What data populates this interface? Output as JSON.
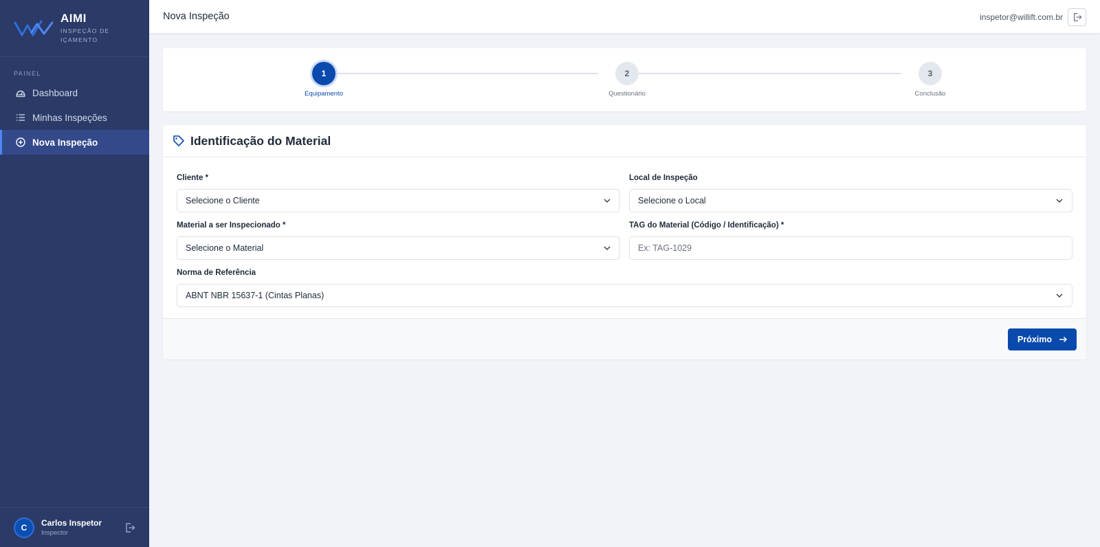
{
  "app": {
    "name": "AIMI",
    "subtitle": "INSPEÇÃO DE IÇAMENTO"
  },
  "sidebar": {
    "section_label": "PAINEL",
    "items": [
      {
        "label": "Dashboard",
        "icon": "dashboard-icon"
      },
      {
        "label": "Minhas Inspeções",
        "icon": "list-icon"
      },
      {
        "label": "Nova Inspeção",
        "icon": "plus-circle-icon",
        "active": true
      }
    ],
    "user": {
      "initial": "C",
      "name": "Carlos Inspetor",
      "role": "Inspector"
    }
  },
  "header": {
    "title": "Nova Inspeção",
    "email": "inspetor@willift.com.br"
  },
  "stepper": {
    "steps": [
      {
        "number": "1",
        "label": "Equipamento",
        "active": true
      },
      {
        "number": "2",
        "label": "Questionário",
        "active": false
      },
      {
        "number": "3",
        "label": "Conclusão",
        "active": false
      }
    ]
  },
  "form": {
    "title": "Identificação do Material",
    "fields": {
      "cliente": {
        "label": "Cliente *",
        "value": "Selecione o Cliente"
      },
      "local": {
        "label": "Local de Inspeção",
        "value": "Selecione o Local"
      },
      "material": {
        "label": "Material a ser Inspecionado *",
        "value": "Selecione o Material"
      },
      "tag": {
        "label": "TAG do Material (Código / Identificação) *",
        "placeholder": "Ex: TAG-1029",
        "value": ""
      },
      "norma": {
        "label": "Norma de Referência",
        "value": "ABNT NBR 15637-1 (Cintas Planas)"
      }
    },
    "next_label": "Próximo"
  },
  "colors": {
    "sidebar_bg": "#2b3a67",
    "primary": "#0a4aad",
    "page_bg": "#f0f3f8"
  }
}
